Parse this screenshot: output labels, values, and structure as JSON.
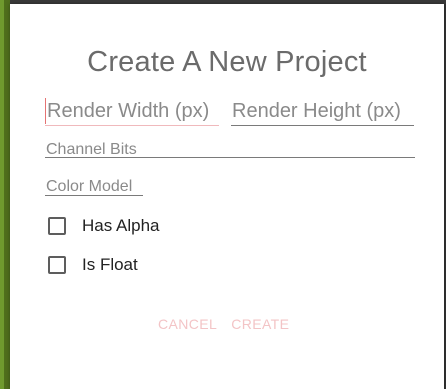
{
  "dialog": {
    "title": "Create A New Project",
    "fields": {
      "render_width_placeholder": "Render Width (px)",
      "render_height_placeholder": "Render Height (px)",
      "channel_bits_placeholder": "Channel Bits",
      "color_model_placeholder": "Color Model"
    },
    "checkboxes": [
      {
        "label": "Has Alpha",
        "checked": false
      },
      {
        "label": "Is Float",
        "checked": false
      }
    ],
    "actions": {
      "cancel_label": "CANCEL",
      "create_label": "CREATE"
    }
  },
  "colors": {
    "accent": "#e57373",
    "disabled_action": "#f3c4c6",
    "title_text": "#6b6b6b",
    "hint_text": "#8a8a8a"
  }
}
